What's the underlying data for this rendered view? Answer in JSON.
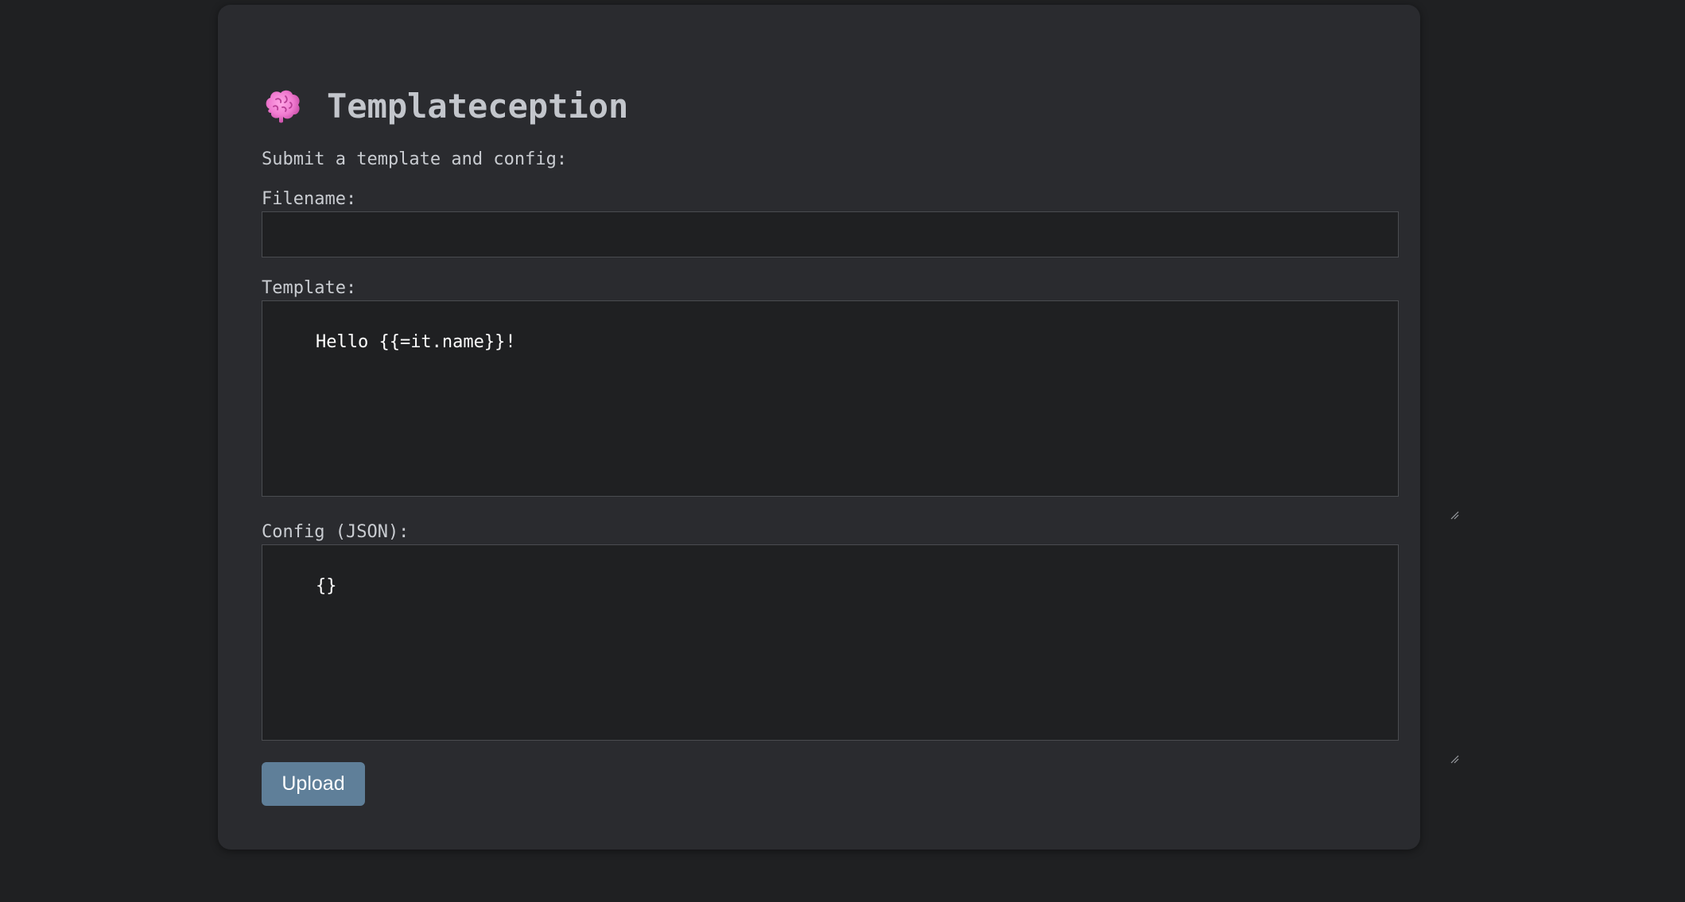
{
  "app": {
    "title": "Templateception",
    "icon": "brain-icon"
  },
  "form": {
    "intro": "Submit a template and config:",
    "filename": {
      "label": "Filename:",
      "value": ""
    },
    "template": {
      "label": "Template:",
      "value": "Hello {{=it.name}}!"
    },
    "config": {
      "label": "Config (JSON):",
      "value": "{}"
    },
    "submit_label": "Upload"
  },
  "colors": {
    "page_bg": "#1f2022",
    "card_bg": "#2a2b2f",
    "input_bg": "#1f2022",
    "button_bg": "#5f7f99",
    "brain_pink": "#f07bd0"
  }
}
